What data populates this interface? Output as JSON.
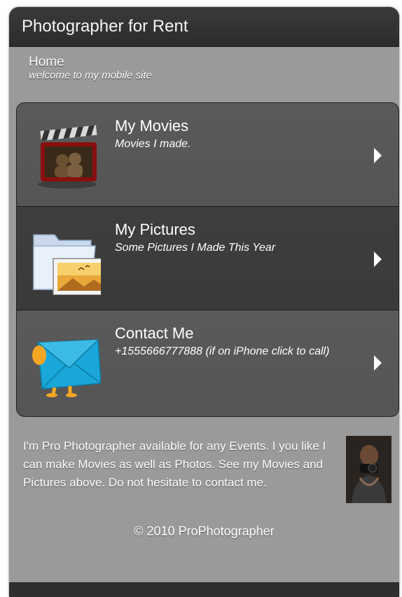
{
  "header": {
    "title": "Photographer for Rent"
  },
  "breadcrumb": {
    "home": "Home",
    "subtitle": "welcome to my mobile site"
  },
  "list": {
    "items": [
      {
        "title": "My Movies",
        "subtitle": "Movies I made.",
        "icon": "clapperboard-icon"
      },
      {
        "title": "My Pictures",
        "subtitle": "Some Pictures I Made This Year",
        "icon": "picture-folder-icon"
      },
      {
        "title": "Contact Me",
        "subtitle": "+1555666777888 (if on iPhone click to call)",
        "icon": "envelope-icon"
      }
    ]
  },
  "about": {
    "text": "I'm Pro Photographer available for any Events. I you like I can make Movies as well as Photos. See my Movies and Pictures above. Do not hesitate to contact me."
  },
  "footer": {
    "copyright": "© 2010 ProPhotographer"
  },
  "colors": {
    "header_bg": "#2e2e2e",
    "page_bg": "#9a9a9a",
    "row_light": "#575757",
    "row_dark": "#3c3c3c"
  }
}
